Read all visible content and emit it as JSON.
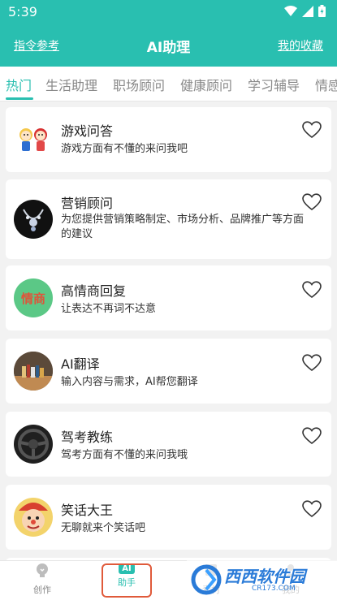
{
  "status_bar": {
    "time": "5:39"
  },
  "header": {
    "left_link": "指令参考",
    "title": "AI助理",
    "right_link": "我的收藏"
  },
  "tabs": [
    {
      "label": "热门",
      "active": true
    },
    {
      "label": "生活助理",
      "active": false
    },
    {
      "label": "职场顾问",
      "active": false
    },
    {
      "label": "健康顾问",
      "active": false
    },
    {
      "label": "学习辅导",
      "active": false
    },
    {
      "label": "情感",
      "active": false
    }
  ],
  "cards": [
    {
      "title": "游戏问答",
      "desc": "游戏方面有不懂的来问我吧",
      "avatar": "cartoon-couple-avatar"
    },
    {
      "title": "营销顾问",
      "desc": "为您提供营销策略制定、市场分析、品牌推广等方面的建议",
      "avatar": "necklace-avatar"
    },
    {
      "title": "高情商回复",
      "desc": "让表达不再词不达意",
      "avatar": "eq-avatar",
      "avatar_text": "情商"
    },
    {
      "title": "AI翻译",
      "desc": "输入内容与需求，AI帮您翻译",
      "avatar": "books-avatar"
    },
    {
      "title": "驾考教练",
      "desc": "驾考方面有不懂的来问我哦",
      "avatar": "steering-wheel-avatar"
    },
    {
      "title": "笑话大王",
      "desc": "无聊就来个笑话吧",
      "avatar": "clown-avatar"
    }
  ],
  "bottom_nav": [
    {
      "label": "创作",
      "icon": "lightbulb-icon"
    },
    {
      "label": "助手",
      "icon": "ai-badge-icon",
      "badge": "AI",
      "active": true
    },
    {
      "label": "素材",
      "icon": "material-icon"
    },
    {
      "label": "我的",
      "icon": "profile-icon"
    }
  ],
  "watermark": {
    "text": "西西软件园",
    "sub": "CR173.COM"
  },
  "colors": {
    "primary": "#29bfb0",
    "highlight_box": "#e05a3a"
  }
}
